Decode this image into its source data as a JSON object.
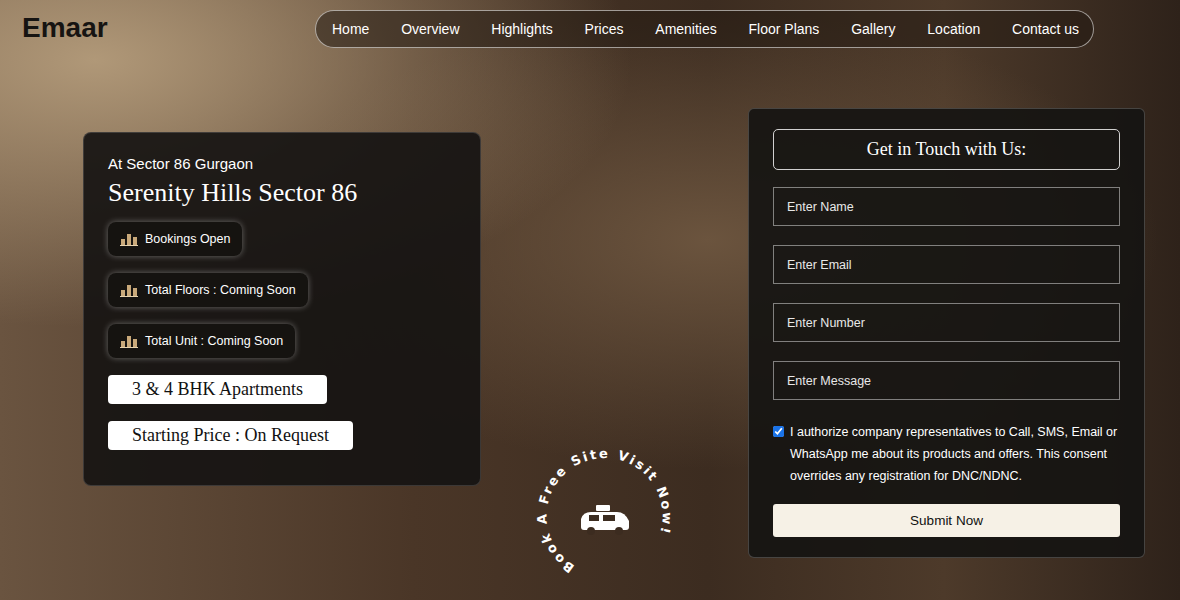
{
  "logo": "Emaar",
  "nav": {
    "items": [
      "Home",
      "Overview",
      "Highlights",
      "Prices",
      "Amenities",
      "Floor Plans",
      "Gallery",
      "Location",
      "Contact us"
    ]
  },
  "project": {
    "location": "At Sector 86 Gurgaon",
    "title": "Serenity Hills Sector 86",
    "chips": [
      "Bookings Open",
      "Total Floors : Coming Soon",
      "Total Unit : Coming Soon"
    ],
    "highlights": [
      "3 & 4 BHK Apartments",
      "Starting Price : On Request"
    ]
  },
  "badge": {
    "text": "Book A Free Site Visit Now!"
  },
  "form": {
    "title": "Get in Touch with Us:",
    "fields": [
      "Enter Name",
      "Enter Email",
      "Enter Number",
      "Enter Message"
    ],
    "consent": {
      "text": "I authorize company representatives to Call, SMS, Email or WhatsApp me about its products and offers. This consent overrides any registration for DNC/NDNC.",
      "checked": true
    },
    "button": "Submit Now"
  }
}
